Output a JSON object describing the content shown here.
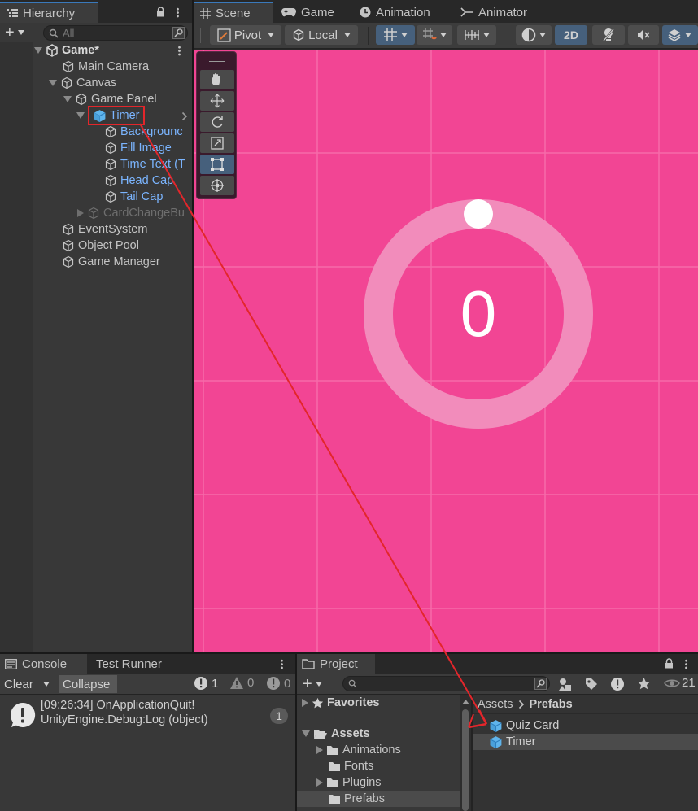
{
  "hierarchy": {
    "tab_label": "Hierarchy",
    "search_placeholder": "All",
    "scene_name": "Game*",
    "items": [
      {
        "label": "Main Camera"
      },
      {
        "label": "Canvas"
      },
      {
        "label": "Game Panel"
      },
      {
        "label": "Timer"
      },
      {
        "label": "Backgrounc"
      },
      {
        "label": "Fill Image"
      },
      {
        "label": "Time Text (T"
      },
      {
        "label": "Head Cap"
      },
      {
        "label": "Tail Cap"
      },
      {
        "label": "CardChangeBu"
      },
      {
        "label": "EventSystem"
      },
      {
        "label": "Object Pool"
      },
      {
        "label": "Game Manager"
      }
    ]
  },
  "scene_tabs": [
    "Scene",
    "Game",
    "Animation",
    "Animator"
  ],
  "scene_toolbar": {
    "pivot": "Pivot",
    "local": "Local",
    "mode_2d": "2D"
  },
  "scene_view": {
    "timer_value": "0",
    "background_color": "#f24594",
    "ring_color": "#f28cbb"
  },
  "console": {
    "tab_label": "Console",
    "tab2_label": "Test Runner",
    "clear": "Clear",
    "collapse": "Collapse",
    "info_count": "1",
    "warn_count": "0",
    "error_count": "0",
    "log": {
      "line1": "[09:26:34] OnApplicationQuit!",
      "line2": "UnityEngine.Debug:Log (object)",
      "count": "1"
    }
  },
  "project": {
    "tab_label": "Project",
    "hidden_count": "21",
    "favorites": "Favorites",
    "assets": "Assets",
    "folders": [
      "Animations",
      "Fonts",
      "Plugins",
      "Prefabs"
    ],
    "breadcrumb": {
      "root": "Assets",
      "current": "Prefabs"
    },
    "files": [
      "Quiz Card",
      "Timer"
    ]
  }
}
